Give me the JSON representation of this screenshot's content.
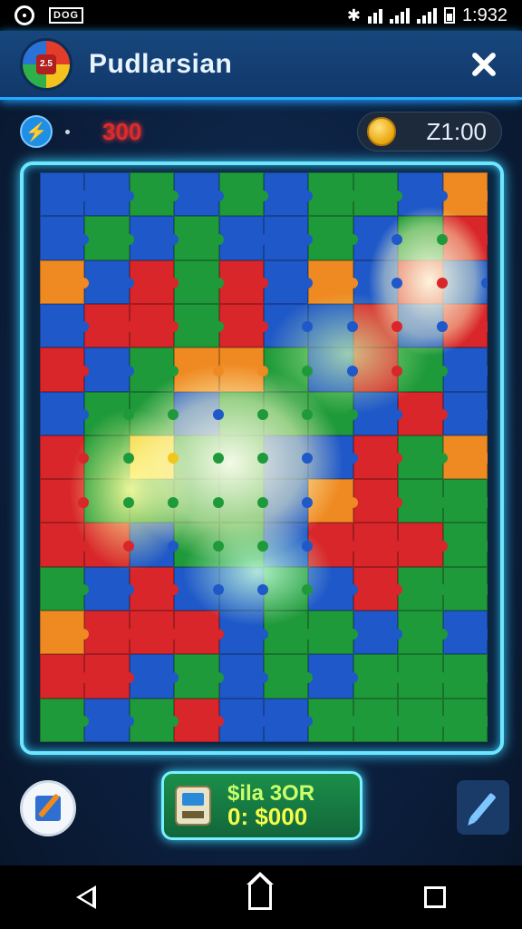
{
  "status_bar": {
    "time": "1:932",
    "icons": [
      "ring-icon",
      "card-icon",
      "bluetooth-icon",
      "wifi-icon",
      "signal-icon",
      "signal-icon",
      "battery-icon"
    ],
    "card_label": "DOG"
  },
  "header": {
    "title": "Pudlarsian",
    "logo_text": "2.5"
  },
  "stats": {
    "score": "300",
    "timer": "Z1:00"
  },
  "offer": {
    "line1": "$ila 3OR",
    "line2": "0: $000"
  },
  "colors": {
    "red": "#d8262a",
    "green": "#1f9a3a",
    "blue": "#1f58c8",
    "orange": "#ef8a22",
    "yellow": "#f0c81c",
    "accent": "#6fe6ff"
  },
  "board": {
    "columns": 10,
    "rows": 13,
    "tiles": [
      "blue",
      "blue",
      "green",
      "blue",
      "green",
      "blue",
      "green",
      "green",
      "blue",
      "orange",
      "blue",
      "green",
      "blue",
      "green",
      "blue",
      "blue",
      "green",
      "blue",
      "green",
      "red",
      "orange",
      "blue",
      "red",
      "green",
      "red",
      "blue",
      "orange",
      "blue",
      "red",
      "blue",
      "blue",
      "red",
      "red",
      "green",
      "red",
      "blue",
      "blue",
      "red",
      "blue",
      "red",
      "red",
      "blue",
      "green",
      "orange",
      "orange",
      "green",
      "blue",
      "red",
      "green",
      "blue",
      "blue",
      "green",
      "green",
      "blue",
      "green",
      "green",
      "green",
      "blue",
      "red",
      "blue",
      "red",
      "green",
      "yellow",
      "green",
      "green",
      "blue",
      "blue",
      "red",
      "green",
      "orange",
      "red",
      "green",
      "green",
      "green",
      "green",
      "blue",
      "orange",
      "red",
      "green",
      "green",
      "red",
      "red",
      "blue",
      "green",
      "green",
      "blue",
      "red",
      "red",
      "red",
      "green",
      "green",
      "blue",
      "red",
      "blue",
      "blue",
      "green",
      "blue",
      "red",
      "green",
      "green",
      "orange",
      "red",
      "red",
      "red",
      "blue",
      "green",
      "green",
      "blue",
      "green",
      "blue",
      "red",
      "red",
      "blue",
      "green",
      "blue",
      "green",
      "blue",
      "green",
      "green",
      "green",
      "green",
      "blue",
      "green",
      "red",
      "blue",
      "blue",
      "green",
      "green",
      "green",
      "green"
    ]
  }
}
